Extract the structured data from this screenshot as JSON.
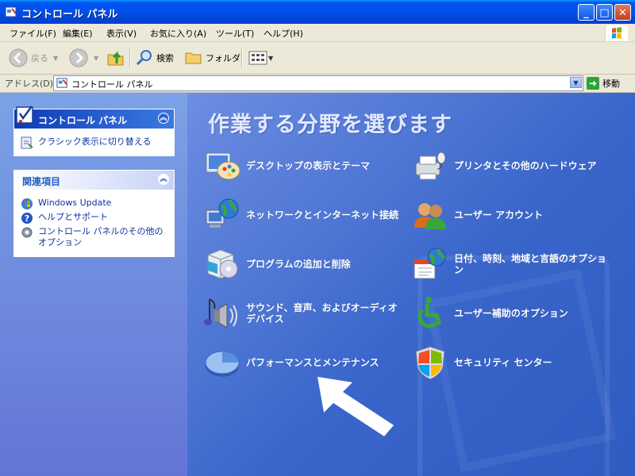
{
  "window": {
    "title": "コントロール パネル"
  },
  "menu": {
    "items": [
      "ファイル(F)",
      "編集(E)",
      "表示(V)",
      "お気に入り(A)",
      "ツール(T)",
      "ヘルプ(H)"
    ]
  },
  "toolbar": {
    "back_label": "戻る",
    "search_label": "検索",
    "folders_label": "フォルダ"
  },
  "address": {
    "label": "アドレス(D)",
    "value": "コントロール パネル",
    "go_label": "移動"
  },
  "left": {
    "cp_panel": {
      "title": "コントロール パネル",
      "switch_link": "クラシック表示に切り替える"
    },
    "related_panel": {
      "title": "関連項目",
      "links": [
        "Windows Update",
        "ヘルプとサポート",
        "コントロール パネルのその他のオプション"
      ]
    }
  },
  "main": {
    "heading": "作業する分野を選びます",
    "categories": [
      {
        "label": "デスクトップの表示とテーマ",
        "icon": "desktop-theme-icon"
      },
      {
        "label": "プリンタとその他のハードウェア",
        "icon": "printer-icon"
      },
      {
        "label": "ネットワークとインターネット接続",
        "icon": "network-icon"
      },
      {
        "label": "ユーザー アカウント",
        "icon": "user-accounts-icon"
      },
      {
        "label": "プログラムの追加と削除",
        "icon": "add-remove-programs-icon"
      },
      {
        "label": "日付、時刻、地域と言語のオプション",
        "icon": "date-time-region-icon"
      },
      {
        "label": "サウンド、音声、およびオーディオ デバイス",
        "icon": "sound-icon"
      },
      {
        "label": "ユーザー補助のオプション",
        "icon": "accessibility-icon"
      },
      {
        "label": "パフォーマンスとメンテナンス",
        "icon": "performance-icon"
      },
      {
        "label": "セキュリティ センター",
        "icon": "security-center-icon"
      }
    ]
  },
  "colors": {
    "title_blue": "#0050ee",
    "main_pane_blue": "#3a66cb",
    "left_pane_blue": "#7ba2e7",
    "arrow_white": "#ffffff"
  }
}
